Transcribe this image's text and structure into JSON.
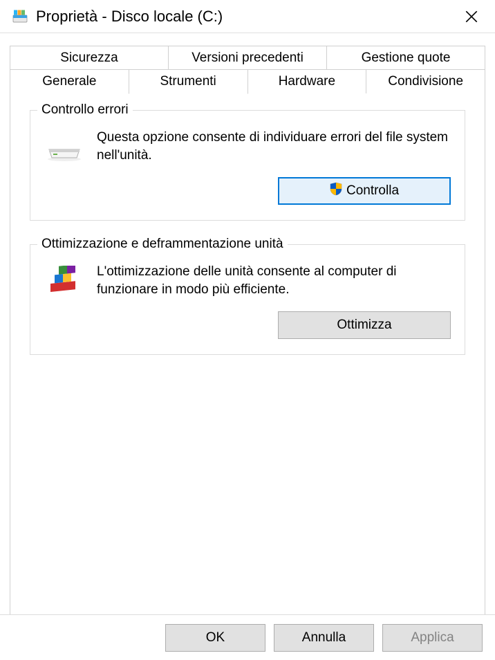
{
  "window": {
    "title": "Proprietà - Disco locale (C:)"
  },
  "tabs": {
    "row_back": [
      "Sicurezza",
      "Versioni precedenti",
      "Gestione quote"
    ],
    "row_front": [
      "Generale",
      "Strumenti",
      "Hardware",
      "Condivisione"
    ],
    "active": "Strumenti"
  },
  "group_check": {
    "legend": "Controllo errori",
    "text": "Questa opzione consente di individuare errori del file system nell'unità.",
    "button": "Controlla"
  },
  "group_optimize": {
    "legend": "Ottimizzazione e deframmentazione unità",
    "text": "L'ottimizzazione delle unità consente al computer di funzionare in modo più efficiente.",
    "button": "Ottimizza"
  },
  "footer": {
    "ok": "OK",
    "cancel": "Annulla",
    "apply": "Applica"
  }
}
